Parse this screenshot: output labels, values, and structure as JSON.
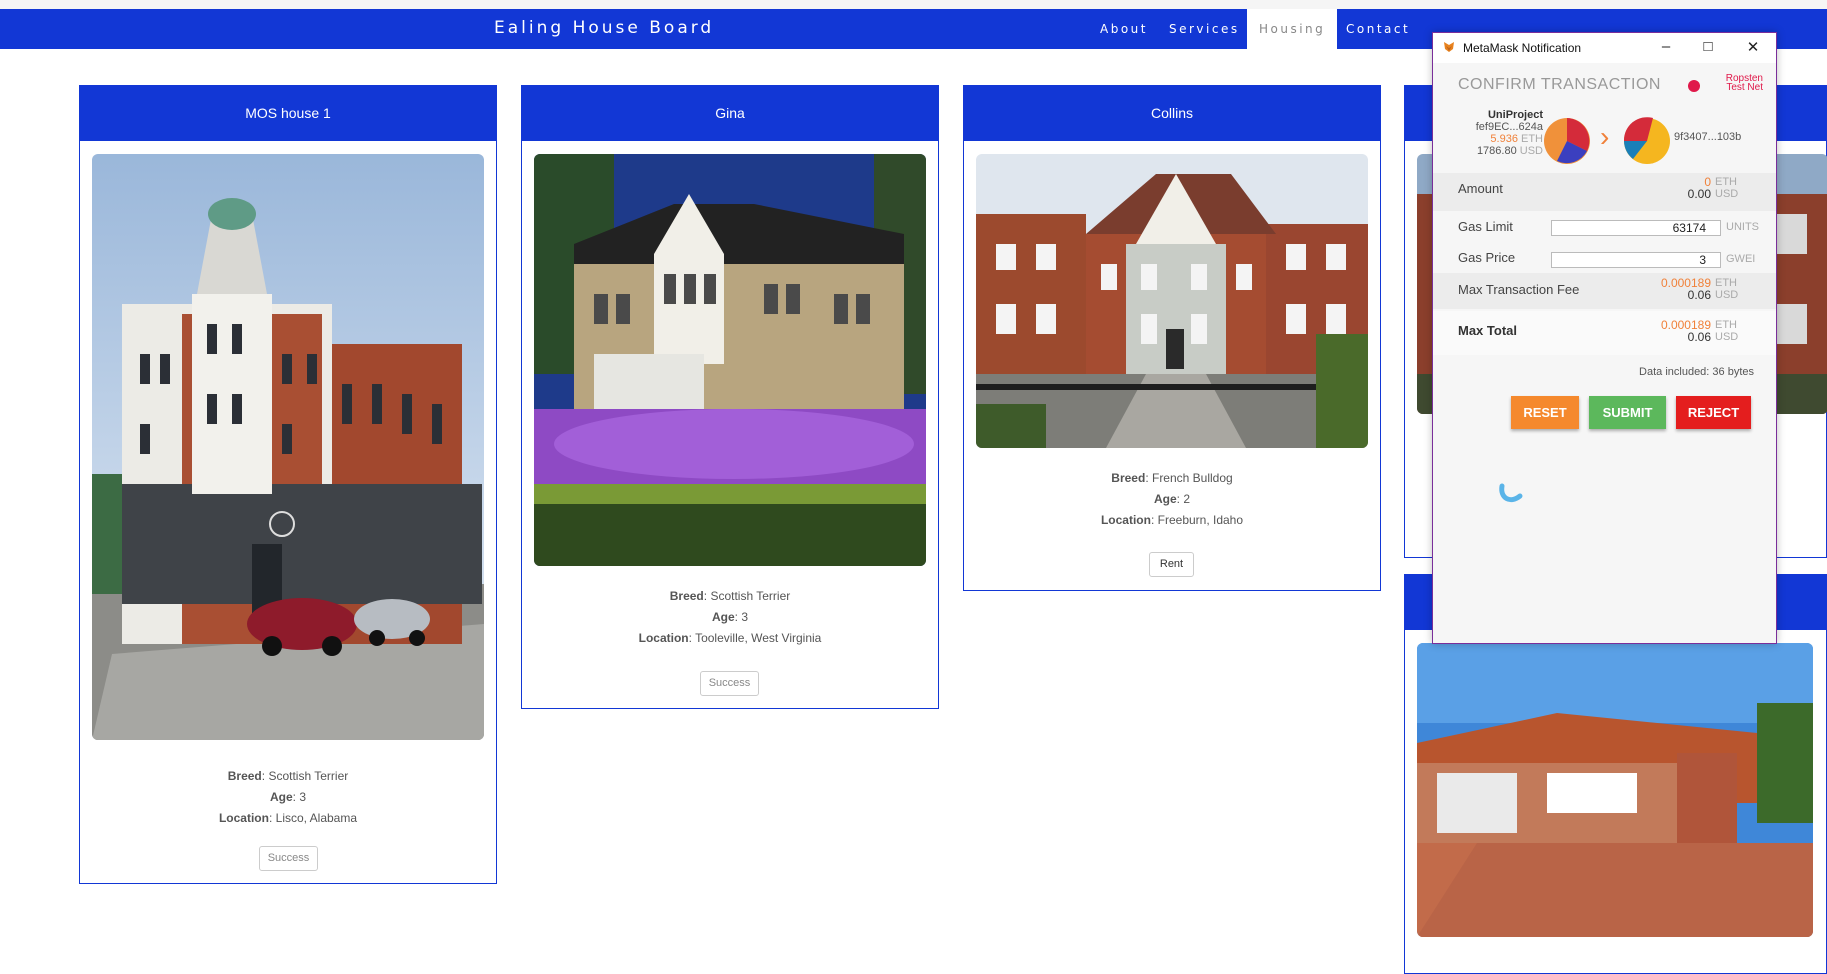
{
  "nav": {
    "brand": "Ealing House Board",
    "items": [
      "About",
      "Services",
      "Housing",
      "Contact"
    ],
    "active": "Housing"
  },
  "cards": [
    {
      "title": "MOS house 1",
      "breed_label": "Breed",
      "breed": "Scottish Terrier",
      "age_label": "Age",
      "age": "3",
      "location_label": "Location",
      "location": "Lisco, Alabama",
      "button": "Success"
    },
    {
      "title": "Gina",
      "breed_label": "Breed",
      "breed": "Scottish Terrier",
      "age_label": "Age",
      "age": "3",
      "location_label": "Location",
      "location": "Tooleville, West Virginia",
      "button": "Success"
    },
    {
      "title": "Collins",
      "breed_label": "Breed",
      "breed": "French Bulldog",
      "age_label": "Age",
      "age": "2",
      "location_label": "Location",
      "location": "Freeburn, Idaho",
      "button": "Rent"
    }
  ],
  "metamask": {
    "window_title": "MetaMask Notification",
    "heading": "CONFIRM TRANSACTION",
    "network": [
      "Ropsten",
      "Test Net"
    ],
    "from_name": "UniProject",
    "from_address": "fef9EC...624a",
    "from_balance_eth": "5.936",
    "eth_unit": "ETH",
    "from_balance_usd": "1786.80",
    "usd_unit": "USD",
    "to_address": "9f3407...103b",
    "amount_label": "Amount",
    "amount_eth": "0",
    "amount_usd": "0.00",
    "gas_limit_label": "Gas Limit",
    "gas_limit": "63174",
    "gas_limit_unit": "UNITS",
    "gas_price_label": "Gas Price",
    "gas_price": "3",
    "gas_price_unit": "GWEI",
    "max_fee_label": "Max Transaction Fee",
    "max_fee_eth": "0.000189",
    "max_fee_usd": "0.06",
    "max_total_label": "Max Total",
    "max_total_eth": "0.000189",
    "max_total_usd": "0.06",
    "data_included": "Data included: 36 bytes",
    "reset": "RESET",
    "submit": "SUBMIT",
    "reject": "REJECT"
  },
  "colors": {
    "brand_blue": "#1237d5",
    "reset": "#f5892d",
    "submit": "#5cb85c",
    "reject": "#e41e1e"
  }
}
